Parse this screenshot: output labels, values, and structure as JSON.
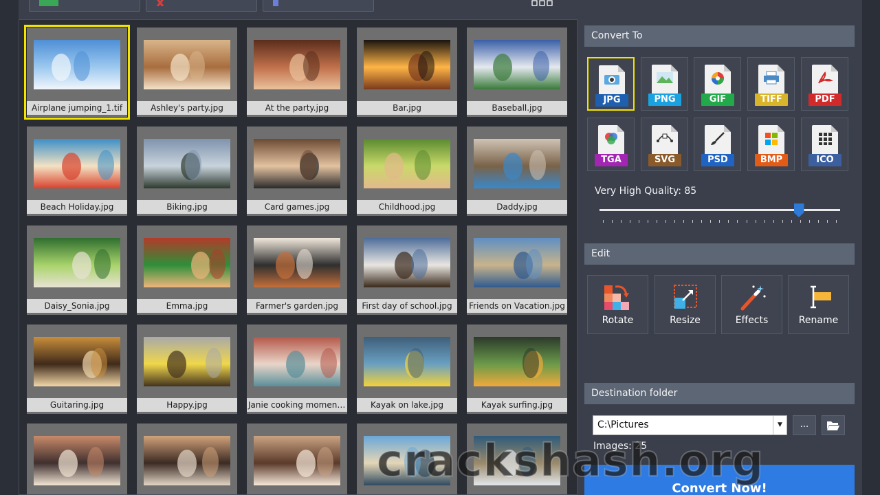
{
  "toolbar": {
    "buttons": [
      {
        "icon": "add-spreadsheet-icon",
        "color": "#3aa757"
      },
      {
        "icon": "remove-x-icon",
        "color": "#e23b3b"
      },
      {
        "icon": "folder-icon",
        "color": "#6a7fd8"
      }
    ],
    "view_modes": [
      "grid-view-icon",
      "list-view-icon"
    ]
  },
  "thumbnails": [
    {
      "name": "Airplane jumping_1.tif",
      "selected": true
    },
    {
      "name": "Ashley's party.jpg"
    },
    {
      "name": "At the party.jpg"
    },
    {
      "name": "Bar.jpg"
    },
    {
      "name": "Baseball.jpg"
    },
    {
      "name": "Beach Holiday.jpg"
    },
    {
      "name": "Biking.jpg"
    },
    {
      "name": "Card games.jpg"
    },
    {
      "name": "Childhood.jpg"
    },
    {
      "name": "Daddy.jpg"
    },
    {
      "name": "Daisy_Sonia.jpg"
    },
    {
      "name": "Emma.jpg"
    },
    {
      "name": "Farmer's garden.jpg"
    },
    {
      "name": "First day of school.jpg"
    },
    {
      "name": "Friends on Vacation.jpg"
    },
    {
      "name": "Guitaring.jpg"
    },
    {
      "name": "Happy.jpg"
    },
    {
      "name": "Janie cooking moments.jpg"
    },
    {
      "name": "Kayak on lake.jpg"
    },
    {
      "name": "Kayak surfing.jpg"
    },
    {
      "name": ""
    },
    {
      "name": ""
    },
    {
      "name": ""
    },
    {
      "name": ""
    },
    {
      "name": ""
    }
  ],
  "sidebar": {
    "convert_to": {
      "title": "Convert To",
      "formats": [
        {
          "label": "JPG",
          "color": "#1f5fb0",
          "selected": true,
          "icon": "camera-icon"
        },
        {
          "label": "PNG",
          "color": "#1aa1e0",
          "icon": "landscape-icon"
        },
        {
          "label": "GIF",
          "color": "#21a94a",
          "icon": "color-wheel-icon"
        },
        {
          "label": "TIFF",
          "color": "#d8b42a",
          "icon": "printer-icon"
        },
        {
          "label": "PDF",
          "color": "#d12a2a",
          "icon": "acrobat-icon"
        },
        {
          "label": "TGA",
          "color": "#a325b4",
          "icon": "rgb-circles-icon"
        },
        {
          "label": "SVG",
          "color": "#8a5a2b",
          "icon": "bezier-pen-icon"
        },
        {
          "label": "PSD",
          "color": "#1f63c5",
          "icon": "brush-icon"
        },
        {
          "label": "BMP",
          "color": "#e25b17",
          "icon": "windows-logo-icon"
        },
        {
          "label": "ICO",
          "color": "#3c5fa0",
          "icon": "grid-dots-icon"
        }
      ],
      "quality_label": "Very High Quality: 85",
      "quality_value": 85
    },
    "edit": {
      "title": "Edit",
      "buttons": [
        {
          "label": "Rotate",
          "icon": "rotate-icon"
        },
        {
          "label": "Resize",
          "icon": "resize-icon"
        },
        {
          "label": "Effects",
          "icon": "magic-wand-icon"
        },
        {
          "label": "Rename",
          "icon": "rename-cursor-icon"
        }
      ]
    },
    "destination": {
      "title": "Destination folder",
      "path": "C:\\Pictures",
      "browse_label": "...",
      "images_count": "Images: 25",
      "convert_label": "Convert Now!"
    }
  },
  "watermark": "crackshash.org"
}
